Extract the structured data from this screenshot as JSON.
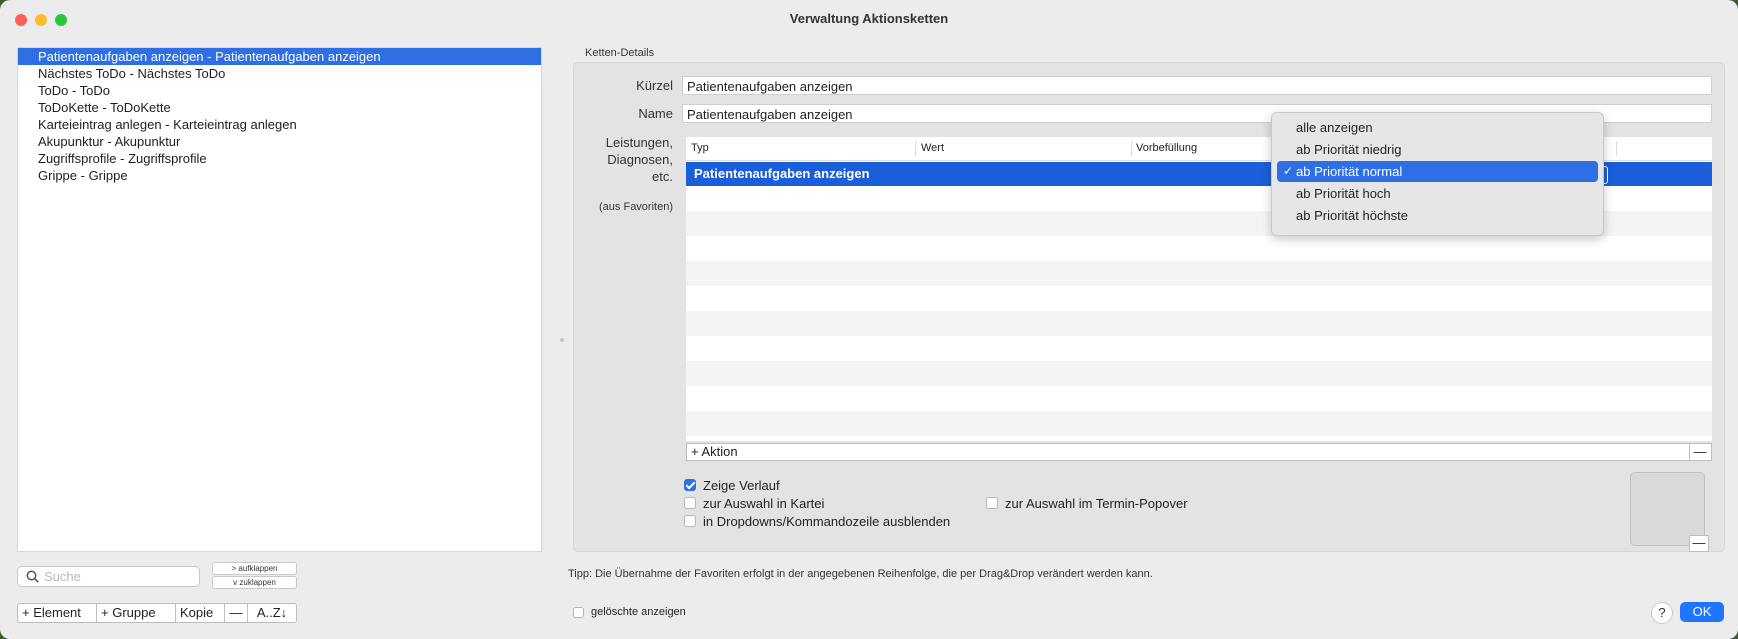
{
  "window": {
    "title": "Verwaltung Aktionsketten"
  },
  "chain_list": {
    "items": [
      "Patientenaufgaben anzeigen - Patientenaufgaben anzeigen",
      "Nächstes ToDo - Nächstes ToDo",
      "ToDo - ToDo",
      "ToDoKette - ToDoKette",
      "Karteieintrag anlegen - Karteieintrag anlegen",
      "Akupunktur  - Akupunktur",
      "Zugriffsprofile - Zugriffsprofile",
      "Grippe - Grippe"
    ],
    "selected_index": 0
  },
  "search": {
    "placeholder": "Suche"
  },
  "expand": {
    "expand_label": "> aufklappen",
    "collapse_label": "v  zuklappen"
  },
  "list_toolbar": {
    "add_element": "+ Element",
    "add_group": "+ Gruppe",
    "copy": "Kopie",
    "remove": "—",
    "sort": "A..Z↓"
  },
  "details": {
    "section_title": "Ketten-Details",
    "kuerzel_label": "Kürzel",
    "kuerzel_value": "Patientenaufgaben anzeigen",
    "name_label": "Name",
    "name_value": "Patientenaufgaben anzeigen",
    "leistungen_label_1": "Leistungen,",
    "leistungen_label_2": "Diagnosen,",
    "leistungen_label_3": "etc.",
    "favoriten_label": "(aus Favoriten)"
  },
  "table": {
    "columns": [
      "Typ",
      "Wert",
      "Vorbefüllung"
    ],
    "rows": [
      {
        "typ": "Patientenaufgaben anzeigen"
      }
    ],
    "add_action": "+ Aktion",
    "remove_action": "—"
  },
  "dropdown": {
    "options": [
      "alle anzeigen",
      "ab Priorität niedrig",
      "ab Priorität normal",
      "ab Priorität hoch",
      "ab Priorität höchste"
    ],
    "selected_index": 2
  },
  "options": {
    "zeige_verlauf": {
      "label": "Zeige Verlauf",
      "checked": true
    },
    "auswahl_kartei": {
      "label": "zur Auswahl in Kartei",
      "checked": false
    },
    "auswahl_termin": {
      "label": "zur Auswahl im Termin-Popover",
      "checked": false
    },
    "dropdown_ausblenden": {
      "label": "in Dropdowns/Kommandozeile ausblenden",
      "checked": false
    }
  },
  "image_well": {
    "remove": "—"
  },
  "tip": "Tipp: Die Übernahme der Favoriten erfolgt in der angegebenen Reihenfolge, die per Drag&Drop verändert werden kann.",
  "footer": {
    "show_deleted": {
      "label": "gelöschte anzeigen",
      "checked": false
    },
    "help": "?",
    "ok": "OK"
  },
  "colors": {
    "accent": "#2e6fe6",
    "ok_button": "#1f75ff"
  }
}
